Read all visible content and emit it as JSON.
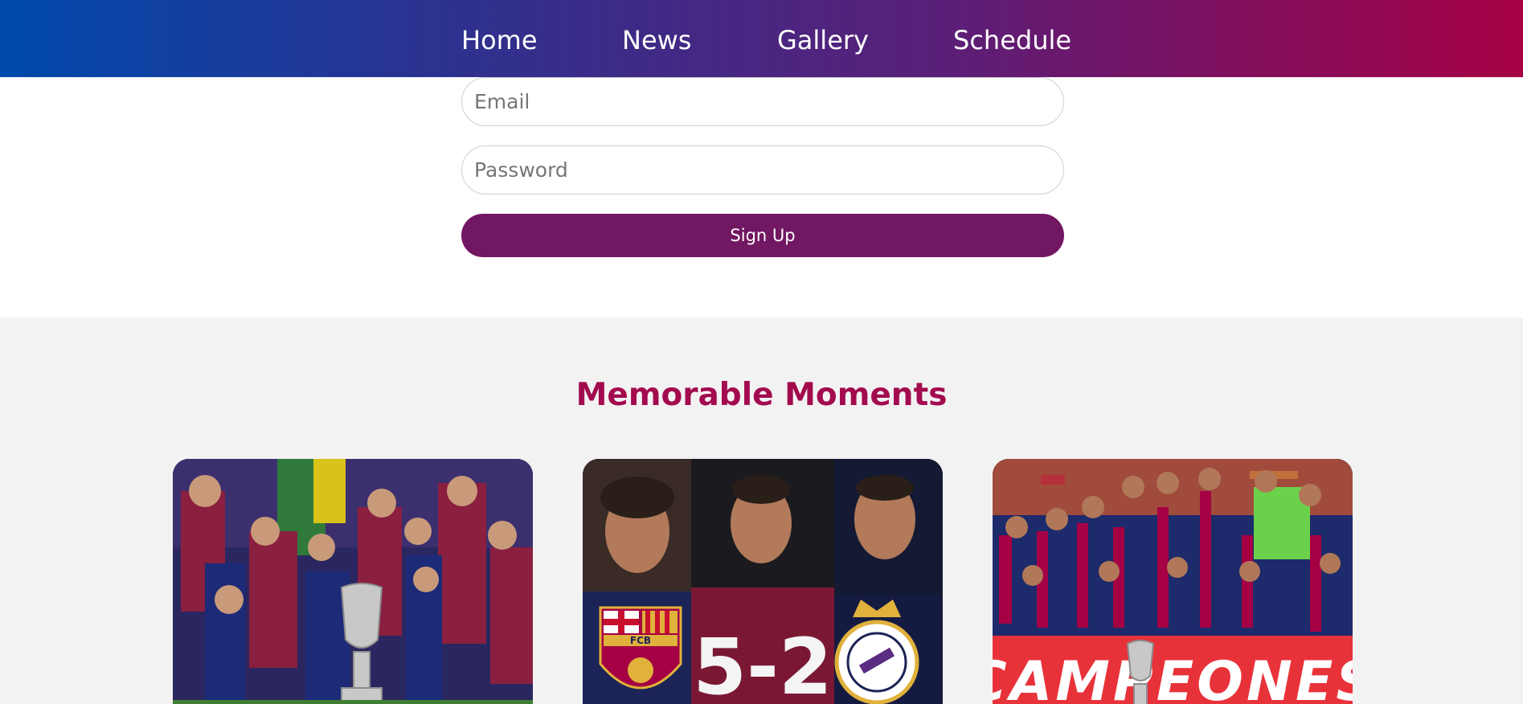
{
  "nav": {
    "items": [
      {
        "label": "Home"
      },
      {
        "label": "News"
      },
      {
        "label": "Gallery"
      },
      {
        "label": "Schedule"
      }
    ]
  },
  "signup": {
    "email_placeholder": "Email",
    "password_placeholder": "Password",
    "submit_label": "Sign Up"
  },
  "moments": {
    "title": "Memorable Moments",
    "cards": [
      {
        "icon": "trophy-celebration-photo"
      },
      {
        "icon": "match-score-photo",
        "score": "5-2",
        "crest_left": "FCB"
      },
      {
        "icon": "team-champions-photo",
        "banner_text": "CAMPEONES"
      }
    ]
  },
  "colors": {
    "nav_gradient_start": "#004aad",
    "nav_gradient_end": "#a50044",
    "accent_purple": "#721762",
    "title_color": "#a30b4f",
    "section_bg": "#f3f2f3"
  }
}
